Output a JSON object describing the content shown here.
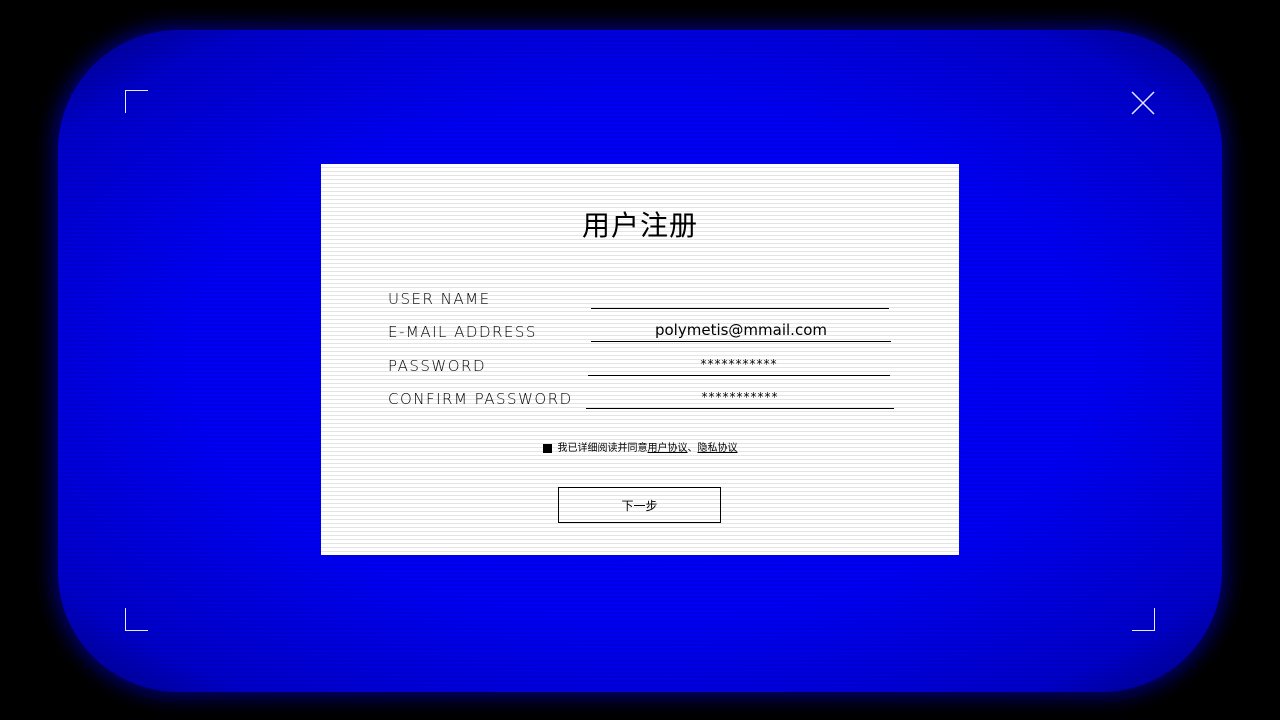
{
  "dialog": {
    "title": "用户注册"
  },
  "fields": {
    "username": {
      "label": "USER NAME",
      "value": ""
    },
    "email": {
      "label": "E-MAIL ADDRESS",
      "value": "polymetis@mmail.com"
    },
    "password": {
      "label": "PASSWORD",
      "value": "***********"
    },
    "confirm_password": {
      "label": "CONFIRM PASSWORD",
      "value": "***********"
    }
  },
  "agreement": {
    "text": "我已详细阅读并同意",
    "link_user": "用户协议",
    "separator": "、",
    "link_privacy": "隐私协议",
    "checked": true
  },
  "next_button": {
    "label": "下一步"
  },
  "colors": {
    "background": "#000000",
    "screen": "#0000ff",
    "panel": "#ffffff",
    "text": "#000000",
    "corner_marks": "#e8e8ff"
  },
  "icons": {
    "close": "close-icon",
    "frame_corners": "corner-bracket-icon"
  }
}
